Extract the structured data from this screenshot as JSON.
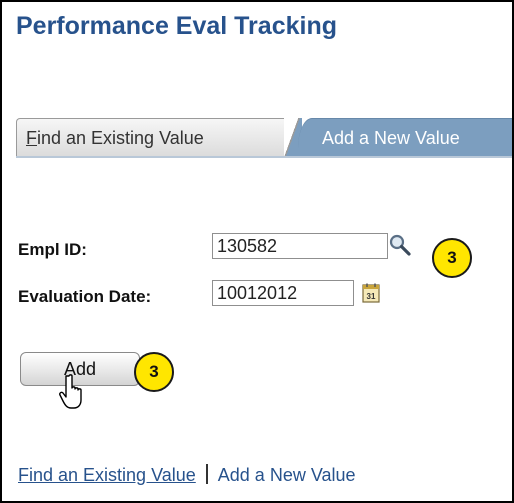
{
  "page": {
    "title": "Performance Eval Tracking"
  },
  "tabs": {
    "find_existing": {
      "first_letter": "F",
      "rest": "ind an Existing Value"
    },
    "add_new": {
      "label": "Add a New Value"
    }
  },
  "form": {
    "empl_id": {
      "label": "Empl ID:",
      "value": "130582"
    },
    "evaluation_date": {
      "label": "Evaluation Date:",
      "value": "10012012"
    },
    "add_button_label": "Add"
  },
  "callouts": {
    "step_empl_id": "3",
    "step_add": "3"
  },
  "footer": {
    "find_existing_link": "Find an Existing Value",
    "add_new_value": "Add a New Value"
  },
  "icons": {
    "lookup": "magnifier-icon",
    "calendar": "calendar-icon",
    "pointer": "hand-cursor-icon"
  },
  "colors": {
    "title": "#27528c",
    "active_tab": "#7c9ebf",
    "callout": "#ffe600"
  }
}
